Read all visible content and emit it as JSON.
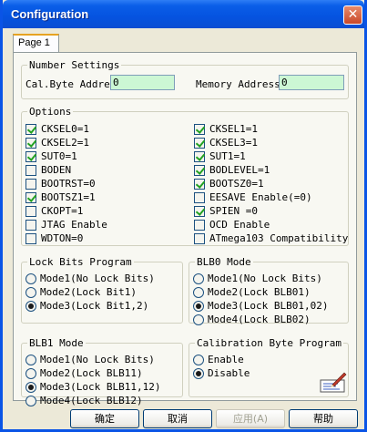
{
  "window": {
    "title": "Configuration",
    "close_glyph": "✕"
  },
  "tabs": [
    {
      "label": "Page 1"
    }
  ],
  "number_settings": {
    "title": "Number Settings",
    "cal_byte_label": "Cal.Byte Addre",
    "cal_byte_value": "0",
    "memory_address_label": "Memory Address",
    "memory_address_value": "0"
  },
  "options": {
    "title": "Options",
    "left": [
      {
        "label": "CKSEL0=1",
        "checked": true
      },
      {
        "label": "CKSEL2=1",
        "checked": true
      },
      {
        "label": "SUT0=1",
        "checked": true
      },
      {
        "label": "BODEN",
        "checked": false
      },
      {
        "label": "BOOTRST=0",
        "checked": false
      },
      {
        "label": "BOOTSZ1=1",
        "checked": true
      },
      {
        "label": "CKOPT=1",
        "checked": false
      },
      {
        "label": "JTAG Enable",
        "checked": false
      },
      {
        "label": "WDTON=0",
        "checked": false
      }
    ],
    "right": [
      {
        "label": "CKSEL1=1",
        "checked": true
      },
      {
        "label": "CKSEL3=1",
        "checked": true
      },
      {
        "label": "SUT1=1",
        "checked": true
      },
      {
        "label": "BODLEVEL=1",
        "checked": true
      },
      {
        "label": "BOOTSZ0=1",
        "checked": true
      },
      {
        "label": "EESAVE Enable(=0)",
        "checked": false
      },
      {
        "label": "SPIEN =0",
        "checked": true
      },
      {
        "label": "OCD Enable",
        "checked": false
      },
      {
        "label": "ATmega103 Compatibility",
        "checked": false
      }
    ]
  },
  "lock_bits": {
    "title": "Lock Bits Program",
    "items": [
      {
        "label": "Mode1(No Lock Bits)",
        "selected": false
      },
      {
        "label": "Mode2(Lock Bit1)",
        "selected": false
      },
      {
        "label": "Mode3(Lock Bit1,2)",
        "selected": true
      }
    ]
  },
  "blb0": {
    "title": "BLB0 Mode",
    "items": [
      {
        "label": "Mode1(No Lock Bits)",
        "selected": false
      },
      {
        "label": "Mode2(Lock BLB01)",
        "selected": false
      },
      {
        "label": "Mode3(Lock BLB01,02)",
        "selected": true
      },
      {
        "label": "Mode4(Lock BLB02)",
        "selected": false
      }
    ]
  },
  "blb1": {
    "title": "BLB1 Mode",
    "items": [
      {
        "label": "Mode1(No Lock Bits)",
        "selected": false
      },
      {
        "label": "Mode2(Lock BLB11)",
        "selected": false
      },
      {
        "label": "Mode3(Lock BLB11,12)",
        "selected": true
      },
      {
        "label": "Mode4(Lock BLB12)",
        "selected": false
      }
    ]
  },
  "calibration": {
    "title": "Calibration Byte Program",
    "items": [
      {
        "label": "Enable",
        "selected": false
      },
      {
        "label": "Disable",
        "selected": true
      }
    ]
  },
  "buttons": {
    "ok": "确定",
    "cancel": "取消",
    "apply": "应用(A)",
    "help": "帮助"
  }
}
